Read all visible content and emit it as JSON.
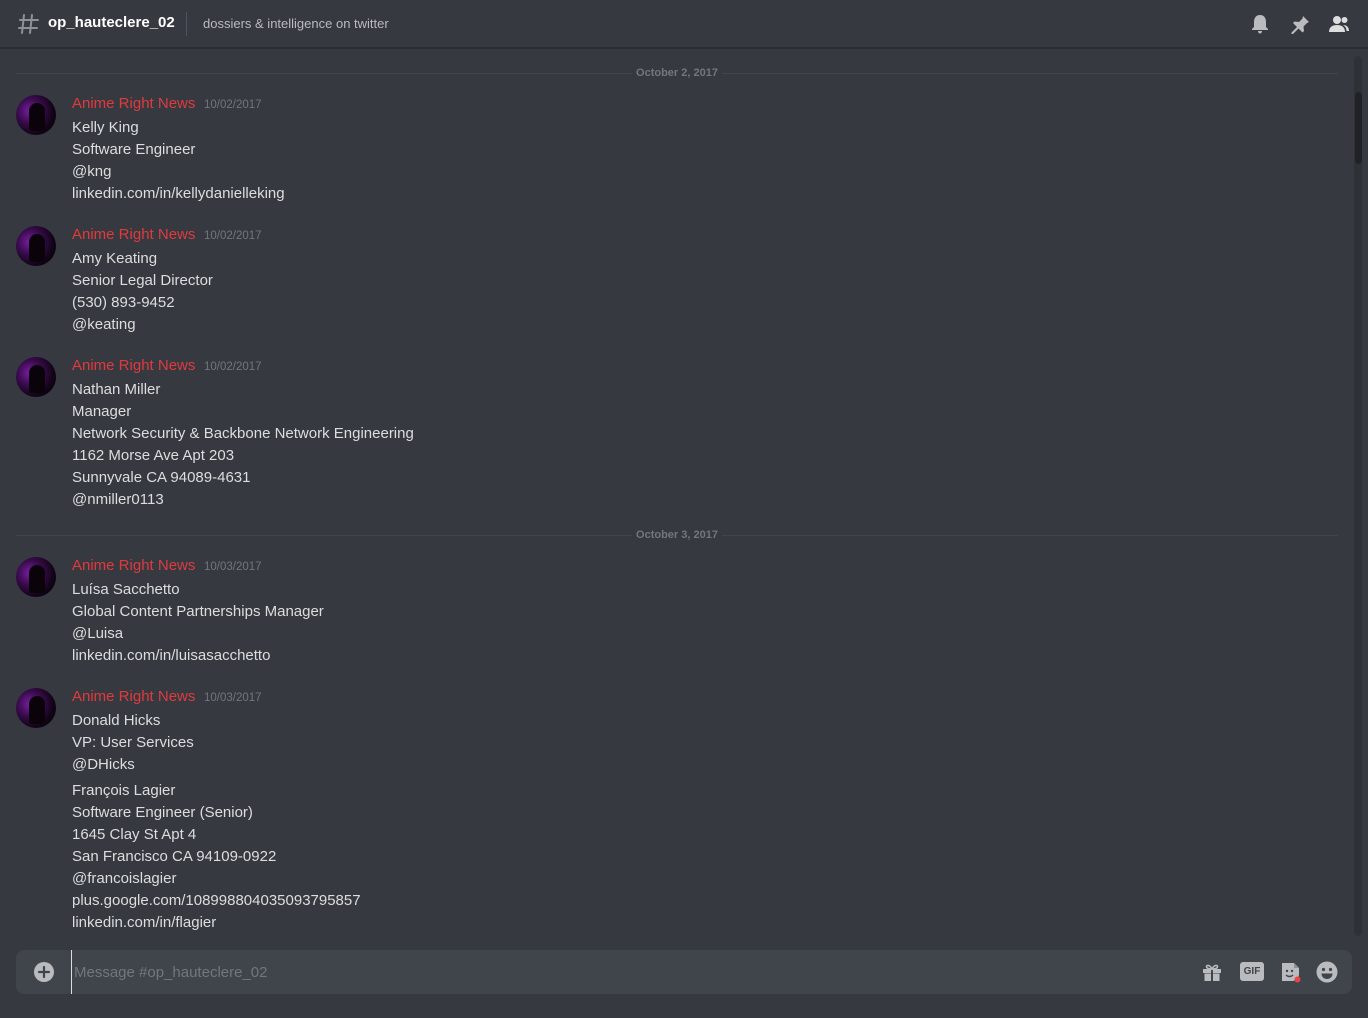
{
  "header": {
    "channel_name": "op_hauteclere_02",
    "topic": "dossiers & intelligence on twitter",
    "icons": [
      "hash-icon",
      "bell-icon",
      "pin-icon",
      "members-icon"
    ]
  },
  "dates": [
    "October 2, 2017",
    "October 3, 2017"
  ],
  "messages": [
    {
      "author": "Anime Right News",
      "timestamp": "10/02/2017",
      "lines": [
        "Kelly King",
        "Software Engineer",
        "@kng",
        "linkedin.com/in/kellydanielleking"
      ]
    },
    {
      "author": "Anime Right News",
      "timestamp": "10/02/2017",
      "lines": [
        "Amy Keating",
        "Senior Legal Director",
        "(530) 893-9452",
        "@keating"
      ]
    },
    {
      "author": "Anime Right News",
      "timestamp": "10/02/2017",
      "lines": [
        "Nathan Miller",
        "Manager",
        "Network Security & Backbone Network Engineering",
        "1162 Morse Ave Apt 203",
        "Sunnyvale CA 94089-4631",
        "@nmiller0113"
      ]
    },
    {
      "author": "Anime Right News",
      "timestamp": "10/03/2017",
      "lines": [
        "Luísa Sacchetto",
        "Global Content Partnerships Manager",
        "@Luisa",
        "linkedin.com/in/luisasacchetto"
      ]
    },
    {
      "author": "Anime Right News",
      "timestamp": "10/03/2017",
      "lines": [
        "Donald Hicks",
        "VP: User Services",
        "@DHicks"
      ],
      "extra_lines": [
        "François Lagier",
        "Software Engineer (Senior)",
        "1645 Clay St Apt 4",
        "San Francisco CA 94109-0922",
        "@francoislagier",
        "plus.google.com/108998804035093795857",
        "linkedin.com/in/flagier"
      ]
    }
  ],
  "composer": {
    "placeholder": "Message #op_hauteclere_02",
    "value": "",
    "icons": [
      "plus-circle-icon",
      "gift-icon",
      "gif-icon",
      "sticker-icon",
      "emoji-icon"
    ],
    "gif_label": "GIF"
  },
  "colors": {
    "background": "#36393f",
    "author": "#e03a3e",
    "text": "#dcddde",
    "muted": "#72767d",
    "composer": "#40444b"
  }
}
